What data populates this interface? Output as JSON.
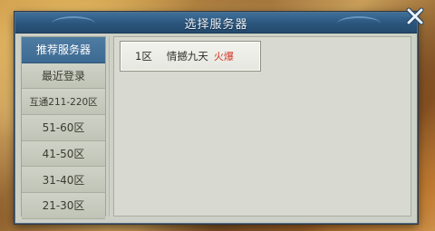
{
  "dialog": {
    "title": "选择服务器"
  },
  "sidebar": {
    "items": [
      {
        "label": "推荐服务器",
        "active": true
      },
      {
        "label": "最近登录",
        "active": false
      },
      {
        "label": "互通211-220区",
        "active": false
      },
      {
        "label": "51-60区",
        "active": false
      },
      {
        "label": "41-50区",
        "active": false
      },
      {
        "label": "31-40区",
        "active": false
      },
      {
        "label": "21-30区",
        "active": false
      }
    ]
  },
  "servers": [
    {
      "zone": "1区",
      "name": "情撼九天",
      "status": "火爆",
      "status_color": "#d23a2a"
    }
  ],
  "colors": {
    "accent": "#3d6a92",
    "status_hot": "#d23a2a"
  },
  "icons": {
    "close": "close-icon"
  }
}
